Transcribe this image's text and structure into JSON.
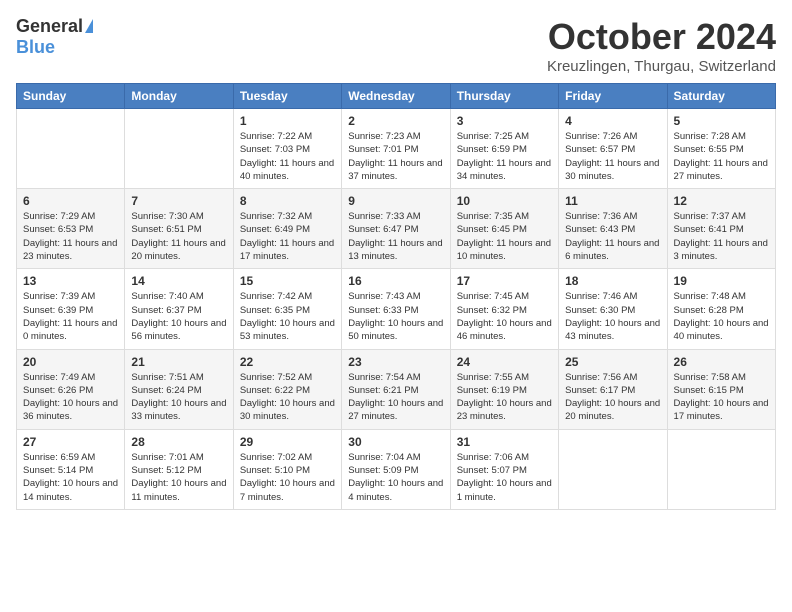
{
  "header": {
    "logo_general": "General",
    "logo_blue": "Blue",
    "title": "October 2024",
    "location": "Kreuzlingen, Thurgau, Switzerland"
  },
  "weekdays": [
    "Sunday",
    "Monday",
    "Tuesday",
    "Wednesday",
    "Thursday",
    "Friday",
    "Saturday"
  ],
  "weeks": [
    [
      {
        "day": "",
        "info": ""
      },
      {
        "day": "",
        "info": ""
      },
      {
        "day": "1",
        "info": "Sunrise: 7:22 AM\nSunset: 7:03 PM\nDaylight: 11 hours and 40 minutes."
      },
      {
        "day": "2",
        "info": "Sunrise: 7:23 AM\nSunset: 7:01 PM\nDaylight: 11 hours and 37 minutes."
      },
      {
        "day": "3",
        "info": "Sunrise: 7:25 AM\nSunset: 6:59 PM\nDaylight: 11 hours and 34 minutes."
      },
      {
        "day": "4",
        "info": "Sunrise: 7:26 AM\nSunset: 6:57 PM\nDaylight: 11 hours and 30 minutes."
      },
      {
        "day": "5",
        "info": "Sunrise: 7:28 AM\nSunset: 6:55 PM\nDaylight: 11 hours and 27 minutes."
      }
    ],
    [
      {
        "day": "6",
        "info": "Sunrise: 7:29 AM\nSunset: 6:53 PM\nDaylight: 11 hours and 23 minutes."
      },
      {
        "day": "7",
        "info": "Sunrise: 7:30 AM\nSunset: 6:51 PM\nDaylight: 11 hours and 20 minutes."
      },
      {
        "day": "8",
        "info": "Sunrise: 7:32 AM\nSunset: 6:49 PM\nDaylight: 11 hours and 17 minutes."
      },
      {
        "day": "9",
        "info": "Sunrise: 7:33 AM\nSunset: 6:47 PM\nDaylight: 11 hours and 13 minutes."
      },
      {
        "day": "10",
        "info": "Sunrise: 7:35 AM\nSunset: 6:45 PM\nDaylight: 11 hours and 10 minutes."
      },
      {
        "day": "11",
        "info": "Sunrise: 7:36 AM\nSunset: 6:43 PM\nDaylight: 11 hours and 6 minutes."
      },
      {
        "day": "12",
        "info": "Sunrise: 7:37 AM\nSunset: 6:41 PM\nDaylight: 11 hours and 3 minutes."
      }
    ],
    [
      {
        "day": "13",
        "info": "Sunrise: 7:39 AM\nSunset: 6:39 PM\nDaylight: 11 hours and 0 minutes."
      },
      {
        "day": "14",
        "info": "Sunrise: 7:40 AM\nSunset: 6:37 PM\nDaylight: 10 hours and 56 minutes."
      },
      {
        "day": "15",
        "info": "Sunrise: 7:42 AM\nSunset: 6:35 PM\nDaylight: 10 hours and 53 minutes."
      },
      {
        "day": "16",
        "info": "Sunrise: 7:43 AM\nSunset: 6:33 PM\nDaylight: 10 hours and 50 minutes."
      },
      {
        "day": "17",
        "info": "Sunrise: 7:45 AM\nSunset: 6:32 PM\nDaylight: 10 hours and 46 minutes."
      },
      {
        "day": "18",
        "info": "Sunrise: 7:46 AM\nSunset: 6:30 PM\nDaylight: 10 hours and 43 minutes."
      },
      {
        "day": "19",
        "info": "Sunrise: 7:48 AM\nSunset: 6:28 PM\nDaylight: 10 hours and 40 minutes."
      }
    ],
    [
      {
        "day": "20",
        "info": "Sunrise: 7:49 AM\nSunset: 6:26 PM\nDaylight: 10 hours and 36 minutes."
      },
      {
        "day": "21",
        "info": "Sunrise: 7:51 AM\nSunset: 6:24 PM\nDaylight: 10 hours and 33 minutes."
      },
      {
        "day": "22",
        "info": "Sunrise: 7:52 AM\nSunset: 6:22 PM\nDaylight: 10 hours and 30 minutes."
      },
      {
        "day": "23",
        "info": "Sunrise: 7:54 AM\nSunset: 6:21 PM\nDaylight: 10 hours and 27 minutes."
      },
      {
        "day": "24",
        "info": "Sunrise: 7:55 AM\nSunset: 6:19 PM\nDaylight: 10 hours and 23 minutes."
      },
      {
        "day": "25",
        "info": "Sunrise: 7:56 AM\nSunset: 6:17 PM\nDaylight: 10 hours and 20 minutes."
      },
      {
        "day": "26",
        "info": "Sunrise: 7:58 AM\nSunset: 6:15 PM\nDaylight: 10 hours and 17 minutes."
      }
    ],
    [
      {
        "day": "27",
        "info": "Sunrise: 6:59 AM\nSunset: 5:14 PM\nDaylight: 10 hours and 14 minutes."
      },
      {
        "day": "28",
        "info": "Sunrise: 7:01 AM\nSunset: 5:12 PM\nDaylight: 10 hours and 11 minutes."
      },
      {
        "day": "29",
        "info": "Sunrise: 7:02 AM\nSunset: 5:10 PM\nDaylight: 10 hours and 7 minutes."
      },
      {
        "day": "30",
        "info": "Sunrise: 7:04 AM\nSunset: 5:09 PM\nDaylight: 10 hours and 4 minutes."
      },
      {
        "day": "31",
        "info": "Sunrise: 7:06 AM\nSunset: 5:07 PM\nDaylight: 10 hours and 1 minute."
      },
      {
        "day": "",
        "info": ""
      },
      {
        "day": "",
        "info": ""
      }
    ]
  ]
}
